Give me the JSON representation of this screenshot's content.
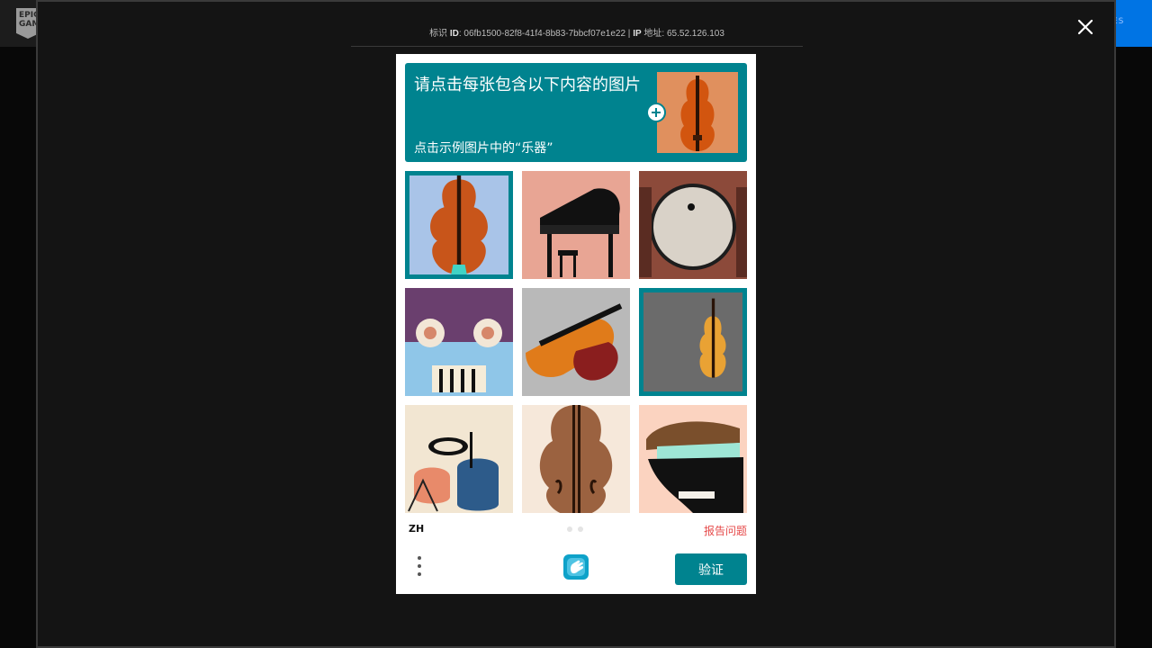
{
  "background": {
    "logo_text": "EPIC GAMES",
    "cta_text": "ES"
  },
  "modal": {
    "meta": {
      "id_prefix": "标识",
      "id_label": "ID",
      "id_value": "06fb1500-82f8-41f4-8b83-7bbcf07e1e22",
      "separator": "|",
      "ip_label": "IP",
      "ip_suffix": "地址",
      "ip_value": "65.52.126.103"
    }
  },
  "captcha": {
    "prompt_title": "请点击每张包含以下内容的图片",
    "prompt_subtitle": "点击示例图片中的“乐器”",
    "lang": "ZH",
    "report_label": "报告问题",
    "submit_label": "验证",
    "tiles": [
      {
        "subject": "violin",
        "selected": true
      },
      {
        "subject": "grand-piano",
        "selected": false
      },
      {
        "subject": "drum",
        "selected": false
      },
      {
        "subject": "abstract-speaker",
        "selected": false
      },
      {
        "subject": "violin-and-guitar",
        "selected": false
      },
      {
        "subject": "violin",
        "selected": true
      },
      {
        "subject": "drum-kit",
        "selected": false
      },
      {
        "subject": "cello",
        "selected": false
      },
      {
        "subject": "grand-piano",
        "selected": false
      }
    ],
    "pagination": {
      "pages": 2,
      "current": 1
    }
  },
  "colors": {
    "accent": "#00838f",
    "report": "#e64a4a",
    "overlay": "#141414"
  }
}
